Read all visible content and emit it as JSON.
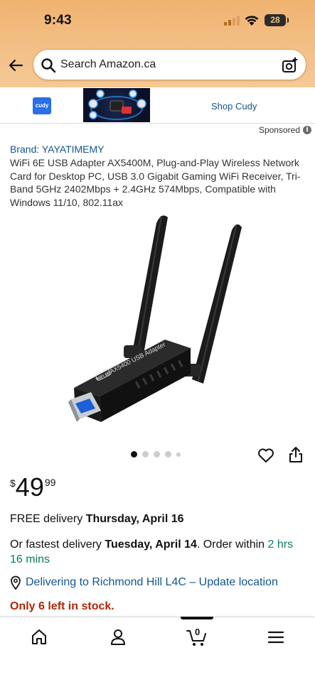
{
  "status_bar": {
    "time": "9:43",
    "battery": "28"
  },
  "search": {
    "placeholder": "Search Amazon.ca"
  },
  "banner": {
    "logo_text": "cudy",
    "shop_label": "Shop Cudy",
    "sponsored_label": "Sponsored"
  },
  "product": {
    "brand": "Brand: YAYATIMEMY",
    "title": "WiFi 6E USB Adapter AX5400M, Plug-and-Play Wireless Network Card for Desktop PC, USB 3.0 Gigabit Gaming WiFi Receiver, Tri-Band 5GHz 2402Mbps + 2.4GHz 574Mbps, Compatible with Windows 11/10, 802.11ax",
    "image_label": "AX5400 USB Adapter",
    "image_badge": "WiFi 6E",
    "price": {
      "currency": "$",
      "whole": "49",
      "fraction": "99"
    },
    "image_count": 5,
    "image_index": 1
  },
  "delivery": {
    "free_prefix": "FREE delivery ",
    "free_date": "Thursday, April 16",
    "fastest_prefix": "Or fastest delivery ",
    "fastest_date": "Tuesday, April 14",
    "order_within": ". Order within ",
    "countdown": "2 hrs 16 mins",
    "location": "Delivering to Richmond Hill L4C – Update location"
  },
  "stock": "Only 6 left in stock.",
  "tabbar": {
    "items": [
      "home-icon",
      "account-icon",
      "cart-icon",
      "menu-icon"
    ],
    "cart_count": "0"
  },
  "colors": {
    "header": "#f3c089",
    "link": "#14568c",
    "accent_green": "#067d62",
    "stock_red": "#b12704"
  }
}
